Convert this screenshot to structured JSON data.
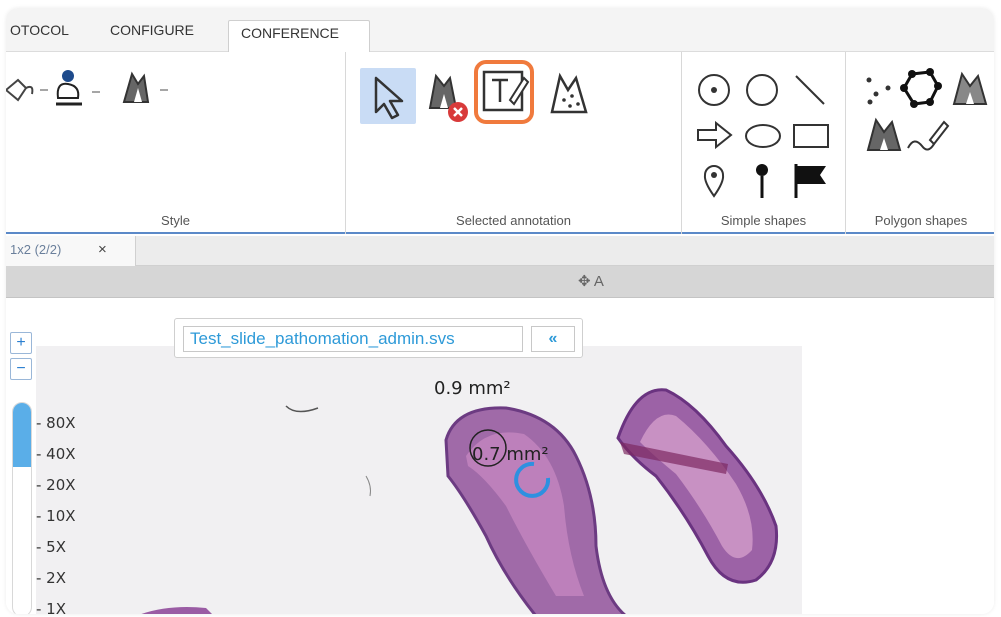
{
  "ribbon": {
    "tabs": [
      "OTOCOL",
      "CONFIGURE",
      "CONFERENCE"
    ],
    "groups": {
      "style": "Style",
      "selected": "Selected annotation",
      "simple": "Simple shapes",
      "polygon": "Polygon shapes"
    },
    "accent_color": "#f07a3d",
    "selection_color": "#c9dcf5"
  },
  "doc_tab": {
    "label": "1x2 (2/2)",
    "close": "×"
  },
  "viewbar": {
    "title": "✥ A"
  },
  "viewer": {
    "zoom_in": "+",
    "zoom_out": "−",
    "zoom_levels": [
      "- 80X",
      "- 40X",
      "- 20X",
      "- 10X",
      "- 5X",
      "- 2X",
      "- 1X"
    ],
    "zoom_level_current": "80X",
    "slide_name": "Test_slide_pathomation_admin.svs",
    "nav_button": "«",
    "annotations": [
      "0.9 mm²",
      "0.7 mm²"
    ]
  }
}
